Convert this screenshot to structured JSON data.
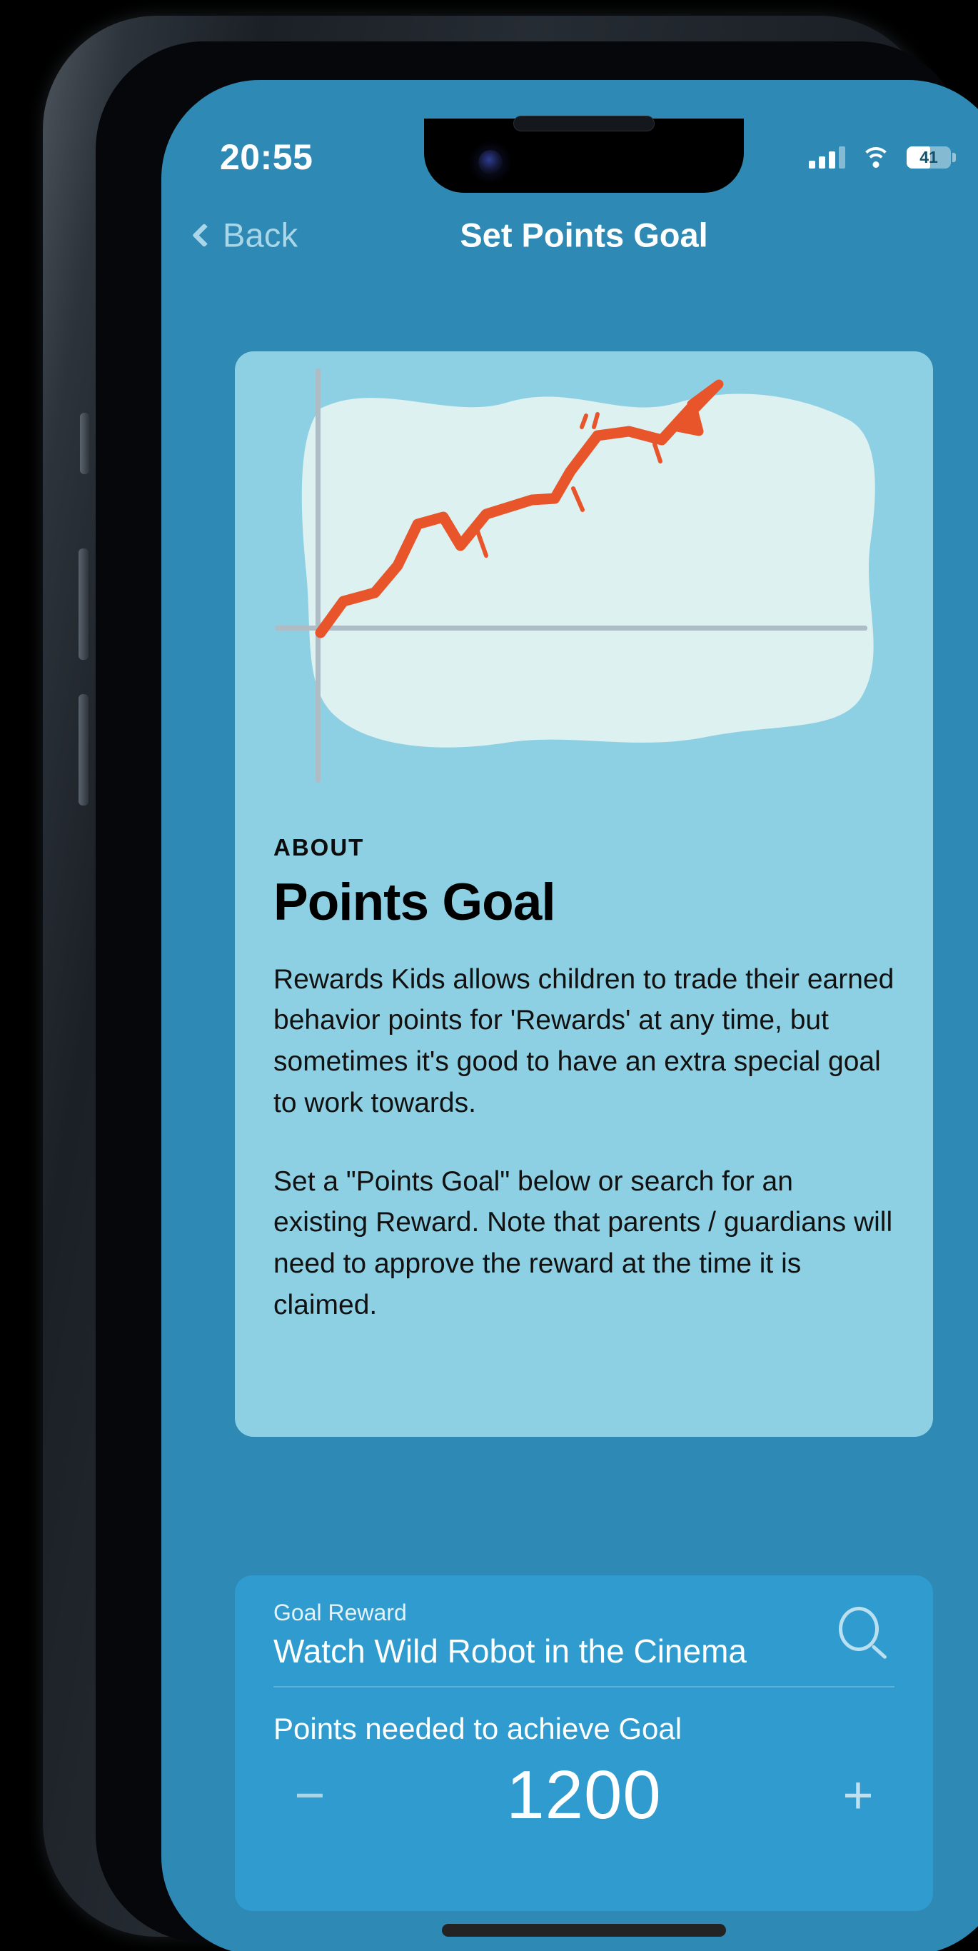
{
  "status_bar": {
    "time": "20:55",
    "battery_percent": "41",
    "signal_icon": "cellular-signal-icon",
    "wifi_icon": "wifi-icon",
    "battery_icon": "battery-icon"
  },
  "nav": {
    "back_label": "Back",
    "back_icon": "chevron-left-icon",
    "title": "Set Points Goal"
  },
  "illustration": {
    "name": "rising-growth-chart-illustration",
    "accent_color": "#e8552b",
    "blob_color": "#ddf1f1",
    "axis_color": "#aebcc6",
    "card_color": "#8ed0e3"
  },
  "about": {
    "eyebrow": "ABOUT",
    "title": "Points Goal",
    "paragraph_1": "Rewards Kids allows children to trade their earned behavior points for 'Rewards' at any time, but sometimes it's good to have an extra special goal to work towards.",
    "paragraph_2": "Set a \"Points Goal\" below or search for an existing Reward. Note that parents / guardians will need to approve the reward at the time it is claimed."
  },
  "form": {
    "goal_reward_label": "Goal Reward",
    "goal_reward_value": "Watch Wild Robot in the Cinema",
    "goal_reward_placeholder": "Goal Reward",
    "search_icon": "search-icon",
    "points_label": "Points needed to achieve Goal",
    "points_value": "1200",
    "decrement_label": "−",
    "increment_label": "+"
  },
  "theme": {
    "page_background": "#2e89b4",
    "card_background": "#8ed0e3",
    "form_background": "#2f9bce",
    "accent_orange": "#e8552b",
    "text_light_blue": "#a9d6e8"
  }
}
